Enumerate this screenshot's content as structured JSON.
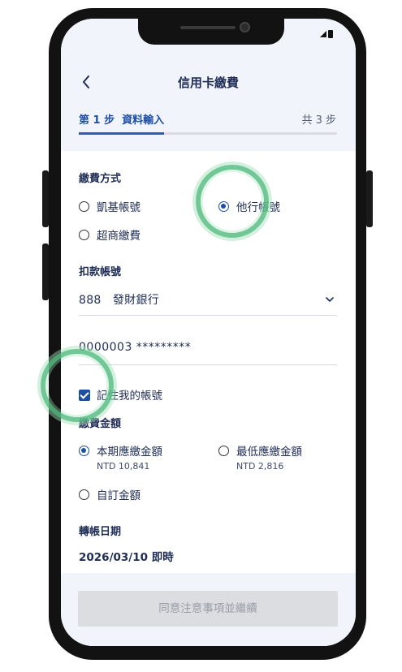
{
  "header": {
    "title": "信用卡繳費"
  },
  "steps": {
    "current_label": "第 1 步  資料輸入",
    "total_label": "共 3 步",
    "progress": 0.33
  },
  "payment_method": {
    "title": "繳費方式",
    "options": [
      {
        "label": "凱基帳號",
        "selected": false
      },
      {
        "label": "他行帳號",
        "selected": true
      },
      {
        "label": "超商繳費",
        "selected": false
      }
    ]
  },
  "debit_account": {
    "title": "扣款帳號",
    "bank_value": "888   發財銀行",
    "account_value": "0000003 *********"
  },
  "remember": {
    "label": "記住我的帳號",
    "checked": true
  },
  "amount": {
    "title": "繳費金額",
    "options": [
      {
        "label": "本期應繳金額",
        "sub": "NTD 10,841",
        "selected": true
      },
      {
        "label": "最低應繳金額",
        "sub": "NTD 2,816",
        "selected": false
      },
      {
        "label": "自訂金額",
        "sub": "",
        "selected": false
      }
    ]
  },
  "transfer_date": {
    "title": "轉帳日期",
    "value": "2026/03/10 即時"
  },
  "footer": {
    "continue_label": "同意注意事項並繼續"
  },
  "colors": {
    "accent": "#1d4fa3",
    "highlight": "#58be84",
    "button_disabled": "#dcdde1"
  }
}
